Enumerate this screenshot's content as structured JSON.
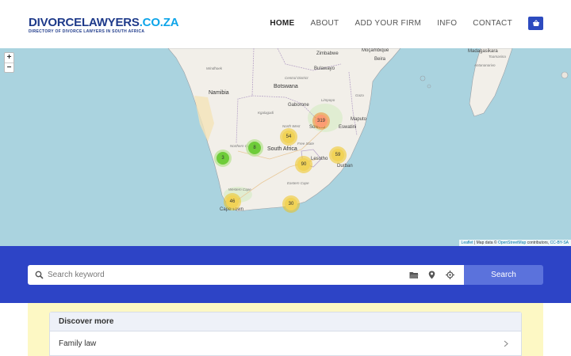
{
  "header": {
    "logo": {
      "main": "DIVORCELAWYERS",
      "tld": ".CO.ZA",
      "tagline": "DIRECTORY OF DIVORCE LAWYERS IN SOUTH AFRICA"
    },
    "nav": [
      {
        "label": "HOME",
        "active": true
      },
      {
        "label": "ABOUT"
      },
      {
        "label": "ADD YOUR FIRM"
      },
      {
        "label": "INFO"
      },
      {
        "label": "CONTACT"
      }
    ],
    "cart_icon": "basket-icon"
  },
  "map": {
    "zoom_in": "+",
    "zoom_out": "−",
    "labels": {
      "namibia": "Namibia",
      "botswana": "Botswana",
      "south_africa": "South Africa",
      "lesotho": "Lesotho",
      "eswatini": "Eswatini",
      "zimbabwe": "Zimbabwe",
      "mocambique": "Moçambique",
      "madagasikara": "Madagasikara",
      "gaborone": "Gaborone",
      "bulawayo": "Bulawayo",
      "beira": "Beira",
      "maputo": "Maputo",
      "soweto": "Soweto",
      "durban": "Durban",
      "cape_town": "Cape Town",
      "windhoek": "Windhoek",
      "central_district": "Central District",
      "kgalagadi": "Kgalagadi",
      "limpopo": "Limpopo",
      "north_west": "North West",
      "free_state": "Free State",
      "northern_cape": "Northern Cape",
      "eastern_cape": "Eastern Cape",
      "western_cape": "Western Cape",
      "toamasina": "Toamasina",
      "antananarivo": "Antananarivo",
      "gaza": "Gaza"
    },
    "clusters": [
      {
        "count": "319",
        "color": "orange"
      },
      {
        "count": "54",
        "color": "yellow"
      },
      {
        "count": "8",
        "color": "green"
      },
      {
        "count": "3",
        "color": "green"
      },
      {
        "count": "59",
        "color": "yellow"
      },
      {
        "count": "90",
        "color": "yellow"
      },
      {
        "count": "46",
        "color": "yellow"
      },
      {
        "count": "30",
        "color": "yellow"
      }
    ],
    "attribution": {
      "leaflet": "Leaflet",
      "mid": " | Map data © ",
      "osm": "OpenStreetMap",
      "contrib": " contributors, ",
      "license": "CC-BY-SA"
    }
  },
  "search": {
    "placeholder": "Search keyword",
    "button_label": "Search",
    "icons": [
      "search-icon",
      "folder-icon",
      "location-pin-icon",
      "crosshair-icon"
    ]
  },
  "discover": {
    "title": "Discover more",
    "items": [
      {
        "label": "Family law"
      }
    ]
  },
  "colors": {
    "brand_blue": "#2d44c6",
    "search_button": "#5b72dc",
    "map_water": "#aad3df",
    "discover_bg": "#fdf8c4"
  }
}
